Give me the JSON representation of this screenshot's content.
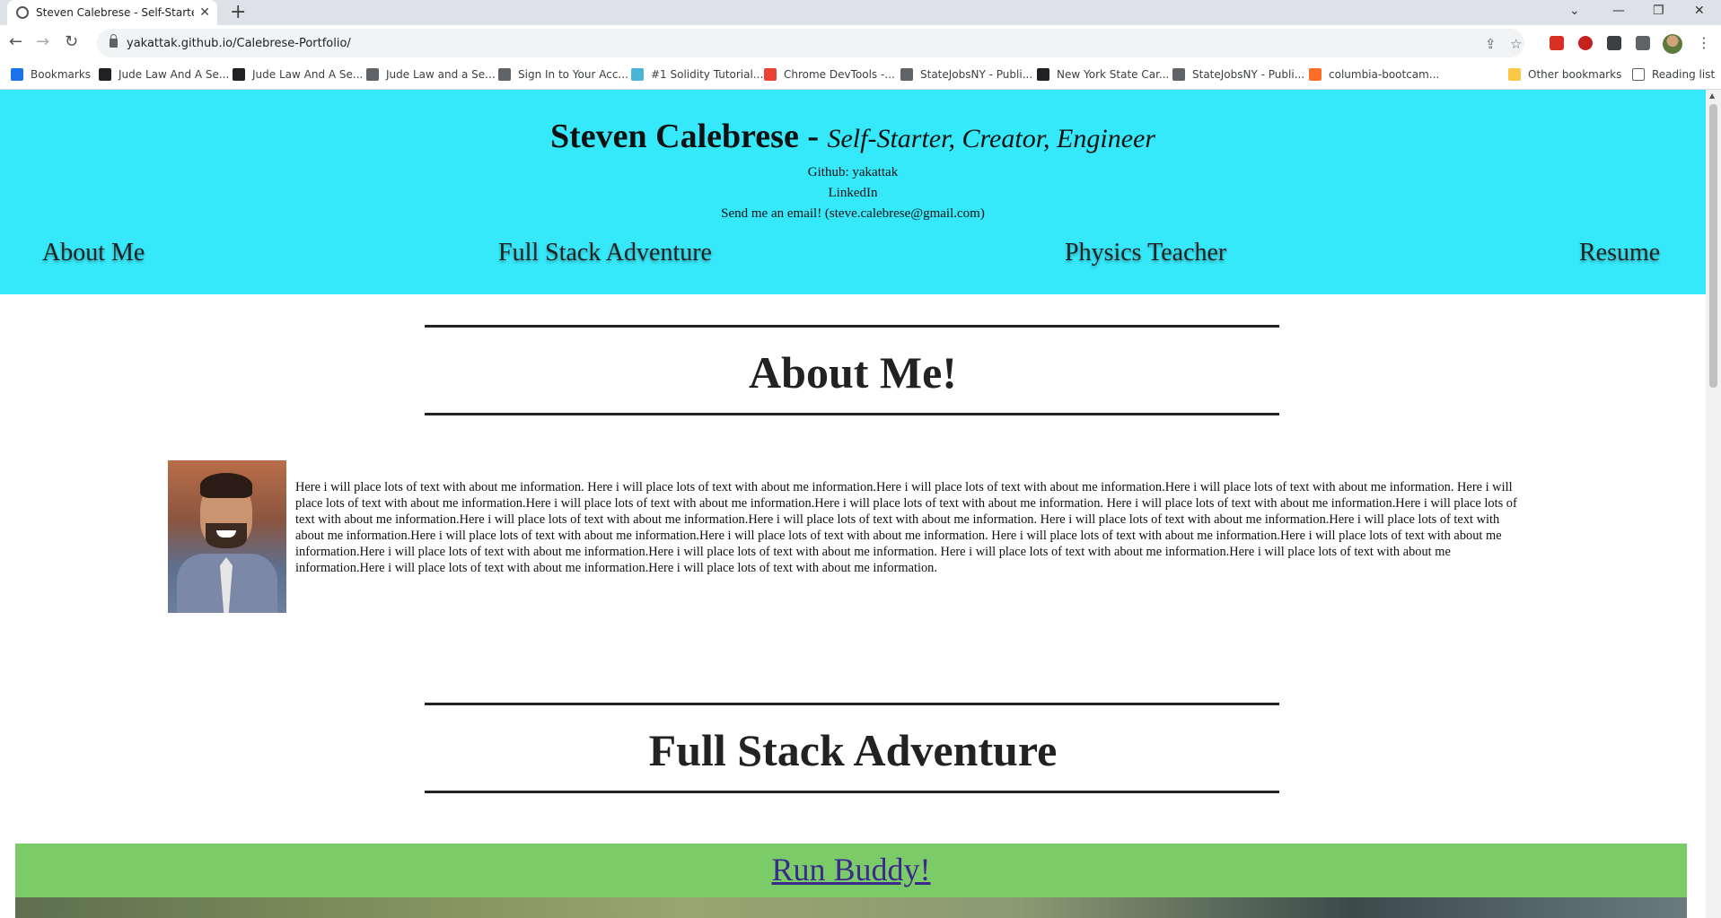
{
  "browser": {
    "tab_title": "Steven Calebrese - Self-Starter, C",
    "tab_close": "✕",
    "new_tab": "+",
    "url": "yakattak.github.io/Calebrese-Portfolio/",
    "bookmarks": [
      {
        "label": "Bookmarks",
        "color": "#1a73e8"
      },
      {
        "label": "Jude Law And A Se...",
        "color": "#202124"
      },
      {
        "label": "Jude Law And A Se...",
        "color": "#202124"
      },
      {
        "label": "Jude Law and a Se...",
        "color": "#5f6368"
      },
      {
        "label": "Sign In to Your Acc...",
        "color": "#5f6368"
      },
      {
        "label": "#1 Solidity Tutorial...",
        "color": "#4ab3d6"
      },
      {
        "label": "Chrome DevTools -...",
        "color": "#ea4335"
      },
      {
        "label": "StateJobsNY - Publi...",
        "color": "#5f6368"
      },
      {
        "label": "New York State Car...",
        "color": "#202124"
      },
      {
        "label": "StateJobsNY - Publi...",
        "color": "#5f6368"
      },
      {
        "label": "columbia-bootcam...",
        "color": "#fc6d26"
      }
    ],
    "other_bookmarks": "Other bookmarks",
    "reading_list": "Reading list"
  },
  "header": {
    "name": "Steven Calebrese - ",
    "tagline": "Self-Starter, Creator, Engineer",
    "github": "Github: yakattak",
    "linkedin": "LinkedIn",
    "email": "Send me an email! (steve.calebrese@gmail.com)",
    "background_color": "#36e9fa"
  },
  "nav": {
    "about": "About Me",
    "fullstack": "Full Stack Adventure",
    "physics": "Physics Teacher",
    "resume": "Resume"
  },
  "about": {
    "heading": "About Me!",
    "text": "Here i will place lots of text with about me information. Here i will place lots of text with about me information.Here i will place lots of text with about me information.Here i will place lots of text with about me information. Here i will place lots of text with about me information.Here i will place lots of text with about me information.Here i will place lots of text with about me information. Here i will place lots of text with about me information.Here i will place lots of text with about me information.Here i will place lots of text with about me information.Here i will place lots of text with about me information. Here i will place lots of text with about me information.Here i will place lots of text with about me information.Here i will place lots of text with about me information.Here i will place lots of text with about me information. Here i will place lots of text with about me information.Here i will place lots of text with about me information.Here i will place lots of text with about me information.Here i will place lots of text with about me information. Here i will place lots of text with about me information.Here i will place lots of text with about me information.Here i will place lots of text with about me information.Here i will place lots of text with about me information."
  },
  "fullstack": {
    "heading": "Full Stack Adventure",
    "project_link": "Run Buddy!",
    "project_bar_color": "#7ccb69"
  }
}
